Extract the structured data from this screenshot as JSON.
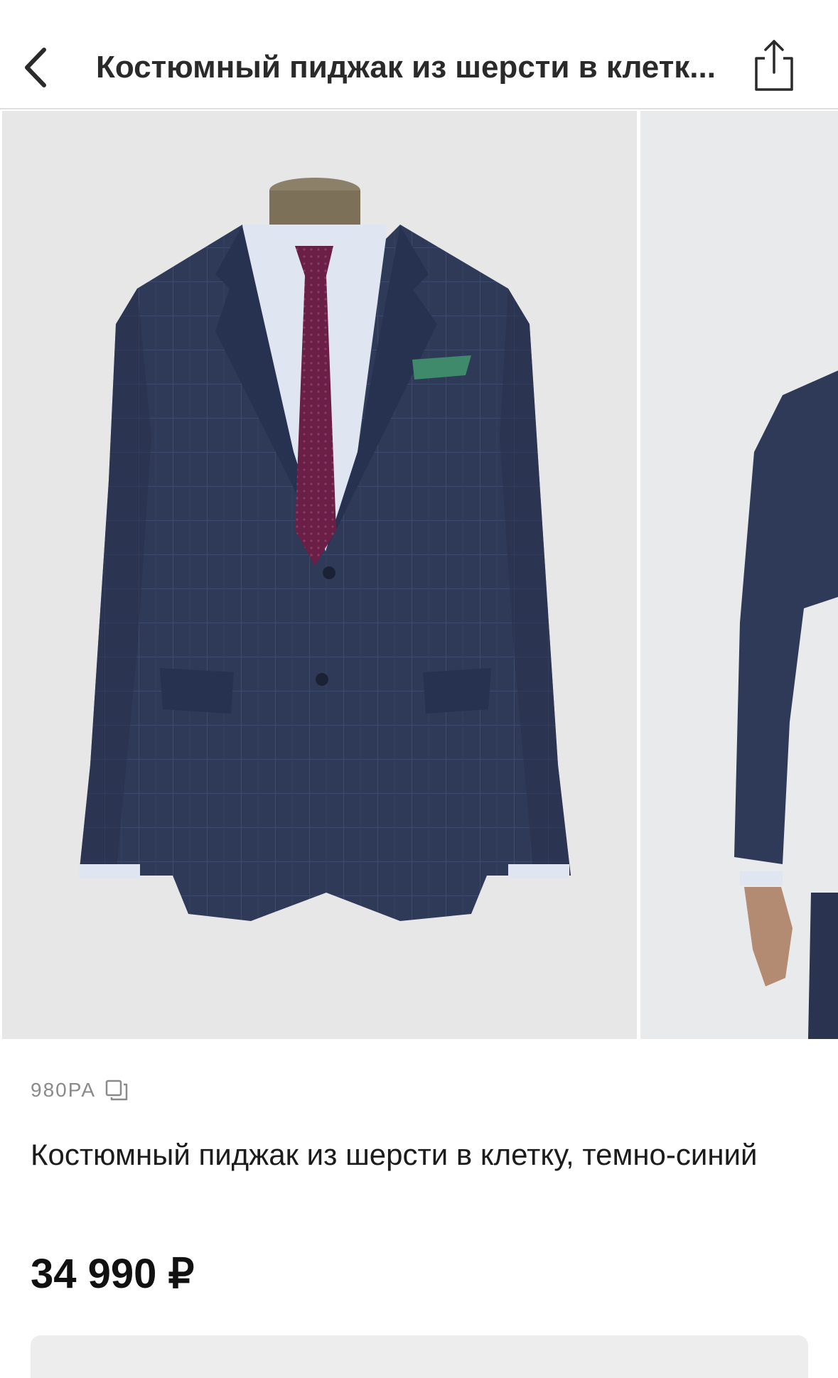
{
  "header": {
    "title": "Костюмный пиджак из шерсти в клетк...",
    "back_icon": "chevron-left-icon",
    "share_icon": "share-icon"
  },
  "gallery": {
    "images": [
      {
        "alt": "jacket-on-mannequin"
      },
      {
        "alt": "jacket-on-model"
      }
    ]
  },
  "product": {
    "sku": "980PA",
    "copy_icon": "copy-icon",
    "name": "Костюмный пиджак из шерсти в клетку, темно-синий",
    "price": "34 990 ₽"
  },
  "colors": {
    "jacket": "#2f3a58",
    "tie": "#6a2046",
    "pocket_square": "#3f8a6a",
    "shirt": "#dfe6f2",
    "background": "#e7e7e8"
  }
}
